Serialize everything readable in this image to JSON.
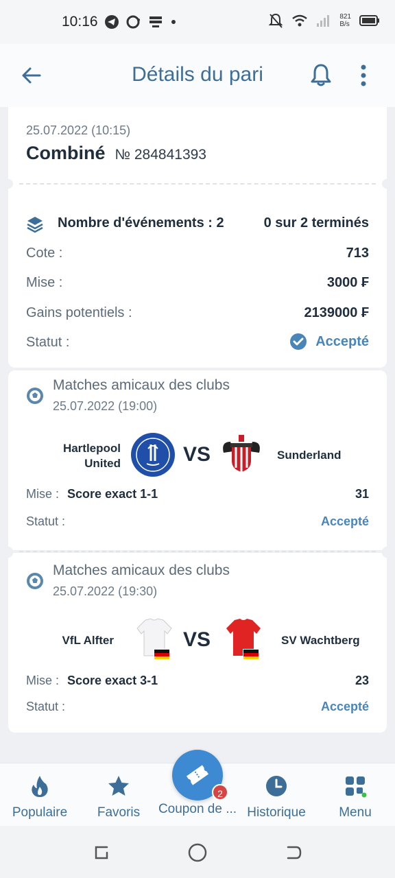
{
  "status_bar": {
    "time": "10:16",
    "net_speed_value": "821",
    "net_speed_unit": "B/s"
  },
  "header": {
    "title": "Détails du pari"
  },
  "bet": {
    "datetime": "25.07.2022 (10:15)",
    "type": "Combiné",
    "number": "№ 284841393"
  },
  "summary": {
    "events_label": "Nombre d'événements : 2",
    "finished": "0 sur 2 terminés",
    "odds_label": "Cote :",
    "odds_value": "713",
    "stake_label": "Mise :",
    "stake_value": "3000 ₣",
    "gains_label": "Gains potentiels :",
    "gains_value": "2139000 ₣",
    "status_label": "Statut :",
    "status_value": "Accepté"
  },
  "events": [
    {
      "league": "Matches amicaux des clubs",
      "datetime": "25.07.2022 (19:00)",
      "home": "Hartlepool United",
      "away": "Sunderland",
      "vs": "VS",
      "stake_label": "Mise :",
      "market": "Score exact 1-1",
      "odds": "31",
      "status_label": "Statut :",
      "status_value": "Accepté"
    },
    {
      "league": "Matches amicaux des clubs",
      "datetime": "25.07.2022 (19:30)",
      "home": "VfL Alfter",
      "away": "SV Wachtberg",
      "vs": "VS",
      "stake_label": "Mise :",
      "market": "Score exact 3-1",
      "odds": "23",
      "status_label": "Statut :",
      "status_value": "Accepté"
    }
  ],
  "bottom_nav": [
    {
      "label": "Populaire",
      "icon": "flame-icon"
    },
    {
      "label": "Favoris",
      "icon": "star-icon"
    },
    {
      "label": "Coupon de ...",
      "icon": "ticket-icon",
      "badge": "2"
    },
    {
      "label": "Historique",
      "icon": "clock-icon"
    },
    {
      "label": "Menu",
      "icon": "grid-menu-icon"
    }
  ],
  "colors": {
    "accent": "#4a85b8",
    "title": "#3d6e98",
    "fab": "#3e8ad2",
    "badge": "#d64545"
  }
}
